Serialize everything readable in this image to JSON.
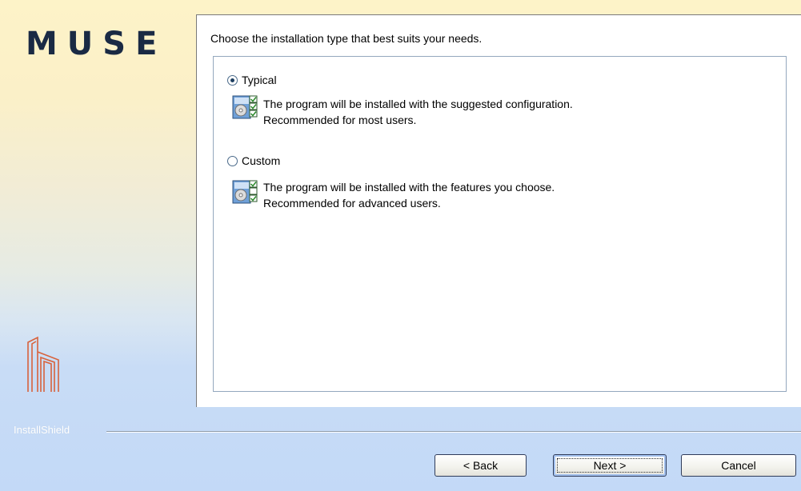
{
  "branding": {
    "logo_text": "MUSE",
    "installshield_label": "InstallShield"
  },
  "main": {
    "instructions": "Choose the installation type that best suits your needs.",
    "options": [
      {
        "label": "Typical",
        "selected": true,
        "icon": "setup-typical-icon",
        "description_line1": "The program will be installed with the suggested configuration.",
        "description_line2": "Recommended for most users."
      },
      {
        "label": "Custom",
        "selected": false,
        "icon": "setup-custom-icon",
        "description_line1": "The program will be installed with the features you choose.",
        "description_line2": "Recommended for advanced users."
      }
    ]
  },
  "buttons": {
    "back": "< Back",
    "next": "Next >",
    "cancel": "Cancel"
  },
  "colors": {
    "logo": "#1a2a44",
    "mark": "#d8623c",
    "accent_focus": "#a4c2f0"
  }
}
